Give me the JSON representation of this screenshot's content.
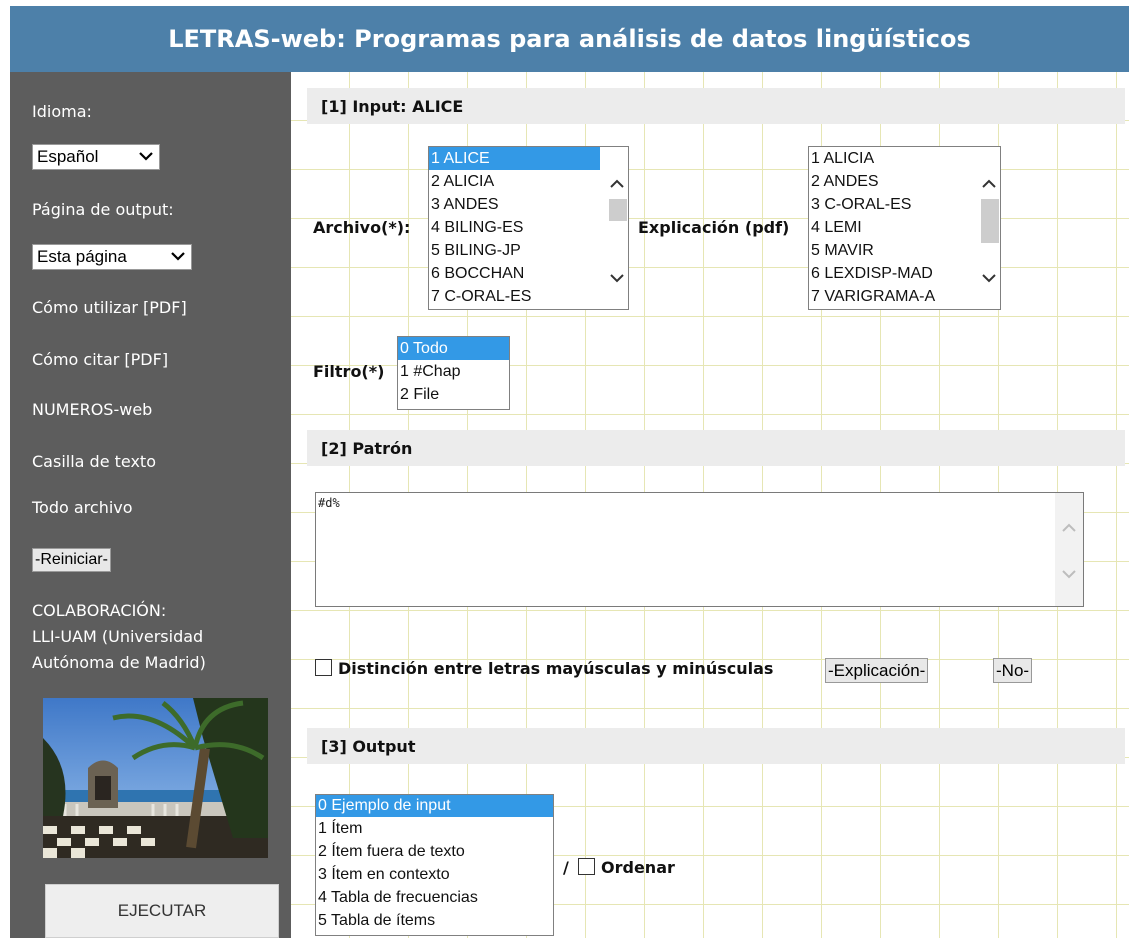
{
  "header": {
    "title": "LETRAS-web: Programas para análisis de datos lingüísticos"
  },
  "sidebar": {
    "language_label": "Idioma:",
    "language_value": "Español",
    "output_page_label": "Página de output:",
    "output_page_value": "Esta página",
    "links": [
      "Cómo utilizar [PDF]",
      "Cómo citar [PDF]",
      "NUMEROS-web",
      "Casilla de texto",
      "Todo archivo"
    ],
    "reset_button": "-Reiniciar-",
    "collaboration": [
      "COLABORACIÓN:",
      "LLI-UAM (Universidad",
      "Autónoma de Madrid)"
    ],
    "execute_button": "EJECUTAR"
  },
  "input_section": {
    "heading": "[1] Input: ALICE",
    "file_label": "Archivo(*):",
    "file_options": [
      "1 ALICE",
      "2 ALICIA",
      "3 ANDES",
      "4 BILING-ES",
      "5 BILING-JP",
      "6 BOCCHAN",
      "7 C-ORAL-ES"
    ],
    "file_selected": "1 ALICE",
    "explanation_label": "Explicación (pdf)",
    "explanation_options": [
      "1 ALICIA",
      "2 ANDES",
      "3 C-ORAL-ES",
      "4 LEMI",
      "5 MAVIR",
      "6 LEXDISP-MAD",
      "7 VARIGRAMA-A"
    ],
    "filter_label": "Filtro(*)",
    "filter_options": [
      "0 Todo",
      "1 #Chap",
      "2 File"
    ],
    "filter_selected": "0 Todo"
  },
  "pattern_section": {
    "heading": "[2] Patrón",
    "pattern_value": "#d%",
    "case_label": "Distinción entre letras mayúsculas y minúsculas",
    "case_checked": false,
    "explanation_button": "-Explicación-",
    "no_button": "-No-"
  },
  "output_section": {
    "heading": "[3] Output",
    "output_options": [
      "0 Ejemplo de input",
      "1 Ítem",
      "2 Ítem fuera de texto",
      "3 Ítem en contexto",
      "4 Tabla de frecuencias",
      "5 Tabla de ítems"
    ],
    "output_selected": "0 Ejemplo de input",
    "separator": "/",
    "sort_label": "Ordenar",
    "sort_checked": false
  },
  "colors": {
    "header_bg": "#4d80a9",
    "sidebar_bg": "#5d5d5d",
    "selection": "#3399e6",
    "section_bg": "#ececec"
  }
}
